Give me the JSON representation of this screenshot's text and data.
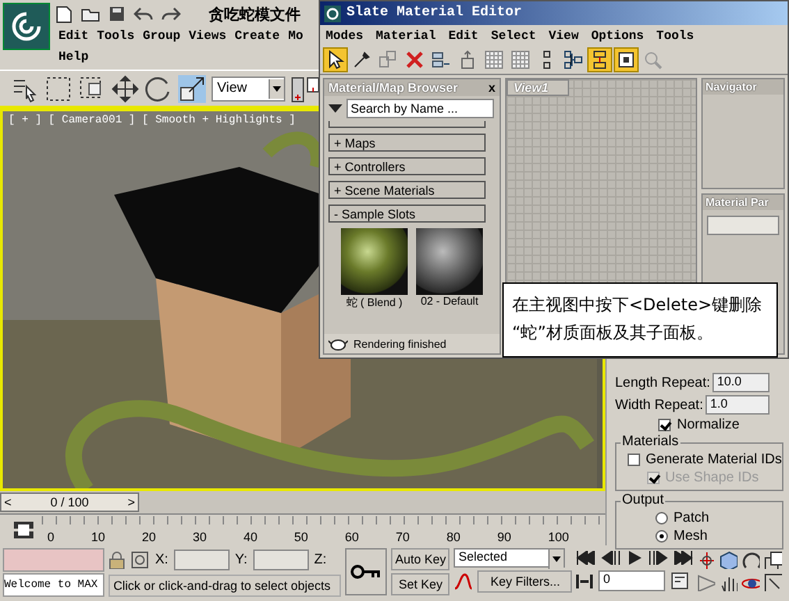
{
  "app": {
    "title": "贪吃蛇模文件"
  },
  "menu_rows": [
    [
      "Edit",
      "Tools",
      "Group",
      "Views",
      "Create",
      "Mo"
    ],
    [
      "Help"
    ]
  ],
  "toolbar": {
    "view_dropdown": "View"
  },
  "viewport": {
    "label": "[ + ] [ Camera001 ] [ Smooth + Highlights ]"
  },
  "editor": {
    "title": "Slate Material Editor",
    "menu": [
      "Modes",
      "Material",
      "Edit",
      "Select",
      "View",
      "Options",
      "Tools"
    ],
    "tools": [
      {
        "kind": "select",
        "on": true
      },
      {
        "kind": "eyedropper",
        "on": false
      },
      {
        "kind": "pick",
        "on": false
      },
      {
        "kind": "delete",
        "on": false
      },
      {
        "kind": "move",
        "on": false
      },
      {
        "kind": "up",
        "on": false
      },
      {
        "kind": "checker",
        "on": false
      },
      {
        "kind": "checker",
        "on": false
      },
      {
        "kind": "dots",
        "on": false
      },
      {
        "kind": "tree",
        "on": false
      },
      {
        "kind": "layout",
        "on": true
      },
      {
        "kind": "panel",
        "on": true
      },
      {
        "kind": "find",
        "on": false
      }
    ]
  },
  "browser": {
    "title": "Material/Map Browser",
    "close": "x",
    "search": {
      "placeholder": "Search by Name ..."
    },
    "groups": [
      "+ Maps",
      "+ Controllers",
      "+ Scene Materials",
      "- Sample Slots"
    ],
    "slots": [
      {
        "label": "蛇 ( Blend )",
        "kind": "textured"
      },
      {
        "label": "02 - Default",
        "kind": "plain"
      }
    ],
    "status": "Rendering finished"
  },
  "view_tab": "View1",
  "navigator": "Navigator",
  "material_params": "Material Par",
  "command_panel": {
    "length_repeat": {
      "label": "Length Repeat:",
      "value": "10.0"
    },
    "width_repeat": {
      "label": "Width Repeat:",
      "value": "1.0"
    },
    "normalize": {
      "label": "Normalize",
      "checked": true
    },
    "materials_group": {
      "title": "Materials",
      "options": [
        {
          "label": "Generate Material IDs",
          "checked": false,
          "disabled": false
        },
        {
          "label": "Use Shape IDs",
          "checked": true,
          "disabled": true
        }
      ]
    },
    "output_group": {
      "title": "Output",
      "options": [
        {
          "label": "Patch",
          "selected": false
        },
        {
          "label": "Mesh",
          "selected": true
        }
      ]
    }
  },
  "timeline": {
    "prev": "<",
    "next": ">",
    "position": "0 / 100",
    "level": 0,
    "ticks": [
      "0",
      "10",
      "20",
      "30",
      "40",
      "50",
      "60",
      "70",
      "80",
      "90",
      "100"
    ]
  },
  "status": {
    "welcome": "Welcome to MAX",
    "prompt": "Click or click-and-drag to select objects",
    "x_label": "X:",
    "y_label": "Y:",
    "z_label": "Z:",
    "auto_key": "Auto Key",
    "set_key": "Set Key",
    "key_mode": "Selected",
    "key_filters": "Key Filters...",
    "frame": "0"
  },
  "callout": "在主视图中按下<Delete>键删除\n“蛇”材质面板及其子面板。"
}
